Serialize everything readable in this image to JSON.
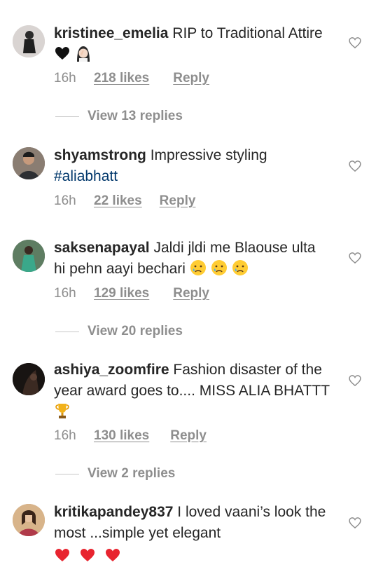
{
  "comments": [
    {
      "username": "kristinee_emelia",
      "text": "RIP to Traditional Attire",
      "time": "16h",
      "likes": "218 likes",
      "reply": "Reply",
      "view_replies": "View 13 replies"
    },
    {
      "username": "shyamstrong",
      "text": "Impressive styling",
      "hashtag": "#aliabhatt",
      "time": "16h",
      "likes": "22 likes",
      "reply": "Reply"
    },
    {
      "username": "saksenapayal",
      "text": "Jaldi jldi me Blaouse ulta hi pehn aayi bechari",
      "time": "16h",
      "likes": "129 likes",
      "reply": "Reply",
      "view_replies": "View 20 replies"
    },
    {
      "username": "ashiya_zoomfire",
      "text": "Fashion disaster of the year award goes to.... MISS ALIA BHATTT",
      "time": "16h",
      "likes": "130 likes",
      "reply": "Reply",
      "view_replies": "View 2 replies"
    },
    {
      "username": "kritikapandey837",
      "text": "I loved vaani’s look the most ...simple yet elegant"
    }
  ],
  "icons": {
    "like": "heart-outline-icon",
    "emoji_black_heart": "black-heart-emoji",
    "emoji_facepalm": "woman-facepalming-emoji",
    "emoji_crying": "crying-face-emoji",
    "emoji_trophy": "trophy-emoji",
    "emoji_red_heart": "red-heart-emoji"
  },
  "colors": {
    "text": "#262626",
    "secondary": "#8e8e8e",
    "hashtag": "#00376b",
    "heart_red": "#ed4956"
  }
}
